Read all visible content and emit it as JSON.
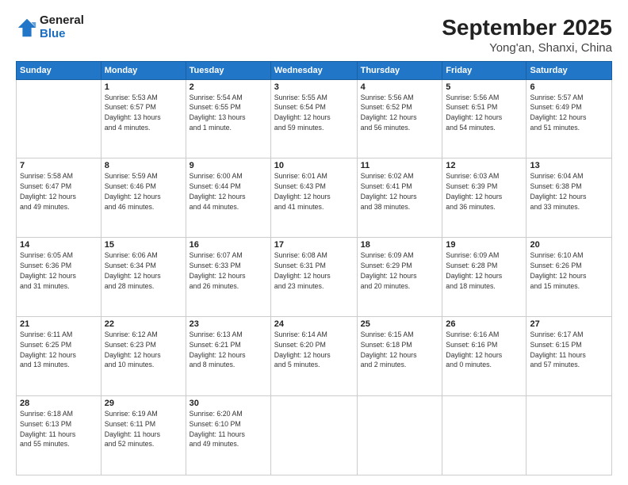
{
  "header": {
    "logo_line1": "General",
    "logo_line2": "Blue",
    "title": "September 2025",
    "subtitle": "Yong'an, Shanxi, China"
  },
  "weekdays": [
    "Sunday",
    "Monday",
    "Tuesday",
    "Wednesday",
    "Thursday",
    "Friday",
    "Saturday"
  ],
  "weeks": [
    [
      {
        "day": "",
        "info": ""
      },
      {
        "day": "1",
        "info": "Sunrise: 5:53 AM\nSunset: 6:57 PM\nDaylight: 13 hours\nand 4 minutes."
      },
      {
        "day": "2",
        "info": "Sunrise: 5:54 AM\nSunset: 6:55 PM\nDaylight: 13 hours\nand 1 minute."
      },
      {
        "day": "3",
        "info": "Sunrise: 5:55 AM\nSunset: 6:54 PM\nDaylight: 12 hours\nand 59 minutes."
      },
      {
        "day": "4",
        "info": "Sunrise: 5:56 AM\nSunset: 6:52 PM\nDaylight: 12 hours\nand 56 minutes."
      },
      {
        "day": "5",
        "info": "Sunrise: 5:56 AM\nSunset: 6:51 PM\nDaylight: 12 hours\nand 54 minutes."
      },
      {
        "day": "6",
        "info": "Sunrise: 5:57 AM\nSunset: 6:49 PM\nDaylight: 12 hours\nand 51 minutes."
      }
    ],
    [
      {
        "day": "7",
        "info": "Sunrise: 5:58 AM\nSunset: 6:47 PM\nDaylight: 12 hours\nand 49 minutes."
      },
      {
        "day": "8",
        "info": "Sunrise: 5:59 AM\nSunset: 6:46 PM\nDaylight: 12 hours\nand 46 minutes."
      },
      {
        "day": "9",
        "info": "Sunrise: 6:00 AM\nSunset: 6:44 PM\nDaylight: 12 hours\nand 44 minutes."
      },
      {
        "day": "10",
        "info": "Sunrise: 6:01 AM\nSunset: 6:43 PM\nDaylight: 12 hours\nand 41 minutes."
      },
      {
        "day": "11",
        "info": "Sunrise: 6:02 AM\nSunset: 6:41 PM\nDaylight: 12 hours\nand 38 minutes."
      },
      {
        "day": "12",
        "info": "Sunrise: 6:03 AM\nSunset: 6:39 PM\nDaylight: 12 hours\nand 36 minutes."
      },
      {
        "day": "13",
        "info": "Sunrise: 6:04 AM\nSunset: 6:38 PM\nDaylight: 12 hours\nand 33 minutes."
      }
    ],
    [
      {
        "day": "14",
        "info": "Sunrise: 6:05 AM\nSunset: 6:36 PM\nDaylight: 12 hours\nand 31 minutes."
      },
      {
        "day": "15",
        "info": "Sunrise: 6:06 AM\nSunset: 6:34 PM\nDaylight: 12 hours\nand 28 minutes."
      },
      {
        "day": "16",
        "info": "Sunrise: 6:07 AM\nSunset: 6:33 PM\nDaylight: 12 hours\nand 26 minutes."
      },
      {
        "day": "17",
        "info": "Sunrise: 6:08 AM\nSunset: 6:31 PM\nDaylight: 12 hours\nand 23 minutes."
      },
      {
        "day": "18",
        "info": "Sunrise: 6:09 AM\nSunset: 6:29 PM\nDaylight: 12 hours\nand 20 minutes."
      },
      {
        "day": "19",
        "info": "Sunrise: 6:09 AM\nSunset: 6:28 PM\nDaylight: 12 hours\nand 18 minutes."
      },
      {
        "day": "20",
        "info": "Sunrise: 6:10 AM\nSunset: 6:26 PM\nDaylight: 12 hours\nand 15 minutes."
      }
    ],
    [
      {
        "day": "21",
        "info": "Sunrise: 6:11 AM\nSunset: 6:25 PM\nDaylight: 12 hours\nand 13 minutes."
      },
      {
        "day": "22",
        "info": "Sunrise: 6:12 AM\nSunset: 6:23 PM\nDaylight: 12 hours\nand 10 minutes."
      },
      {
        "day": "23",
        "info": "Sunrise: 6:13 AM\nSunset: 6:21 PM\nDaylight: 12 hours\nand 8 minutes."
      },
      {
        "day": "24",
        "info": "Sunrise: 6:14 AM\nSunset: 6:20 PM\nDaylight: 12 hours\nand 5 minutes."
      },
      {
        "day": "25",
        "info": "Sunrise: 6:15 AM\nSunset: 6:18 PM\nDaylight: 12 hours\nand 2 minutes."
      },
      {
        "day": "26",
        "info": "Sunrise: 6:16 AM\nSunset: 6:16 PM\nDaylight: 12 hours\nand 0 minutes."
      },
      {
        "day": "27",
        "info": "Sunrise: 6:17 AM\nSunset: 6:15 PM\nDaylight: 11 hours\nand 57 minutes."
      }
    ],
    [
      {
        "day": "28",
        "info": "Sunrise: 6:18 AM\nSunset: 6:13 PM\nDaylight: 11 hours\nand 55 minutes."
      },
      {
        "day": "29",
        "info": "Sunrise: 6:19 AM\nSunset: 6:11 PM\nDaylight: 11 hours\nand 52 minutes."
      },
      {
        "day": "30",
        "info": "Sunrise: 6:20 AM\nSunset: 6:10 PM\nDaylight: 11 hours\nand 49 minutes."
      },
      {
        "day": "",
        "info": ""
      },
      {
        "day": "",
        "info": ""
      },
      {
        "day": "",
        "info": ""
      },
      {
        "day": "",
        "info": ""
      }
    ]
  ]
}
